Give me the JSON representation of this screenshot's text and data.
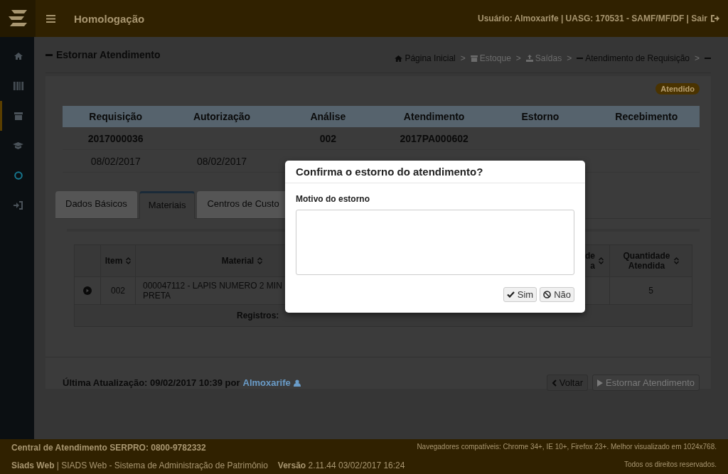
{
  "header": {
    "title": "Homologação",
    "user_info": "Usuário: Almoxarife | UASG: 170531 - SAMF/MF/DF | Sair"
  },
  "sidebar": {
    "items": [
      {
        "kind": "home",
        "selected": false
      },
      {
        "kind": "barcode",
        "selected": false
      },
      {
        "kind": "box",
        "selected": true
      },
      {
        "kind": "cap",
        "selected": false
      },
      {
        "kind": "circle",
        "selected": false
      },
      {
        "kind": "signin",
        "selected": false
      }
    ]
  },
  "page_title": "Estornar Atendimento",
  "breadcrumb": [
    {
      "kind": "home",
      "label": "Página Inicial",
      "disabled": false
    },
    {
      "separator": ">",
      "kind": "box",
      "label": "Estoque",
      "disabled": true
    },
    {
      "separator": ">",
      "kind": "upload",
      "label": "Saídas",
      "disabled": true
    },
    {
      "separator": ">",
      "kind": "dash",
      "label": "Atendimento de Requisição",
      "disabled": false
    },
    {
      "separator": ">",
      "kind": "dash",
      "disabled": false
    }
  ],
  "status_badge": "Atendido",
  "summary": {
    "columns": [
      "Requisição",
      "Autorização",
      "Análise",
      "Atendimento",
      "Estorno",
      "Recebimento"
    ],
    "rows": [
      {
        "bold": true,
        "cells": [
          "2017000036",
          null,
          "002",
          "2017PA000602",
          null,
          null
        ]
      },
      {
        "bold": false,
        "cells": [
          "08/02/2017",
          "08/02/2017",
          null,
          null,
          null,
          null
        ]
      }
    ]
  },
  "tabs": [
    {
      "label": "Dados Básicos",
      "selected": false
    },
    {
      "label": "Materiais",
      "selected": true
    },
    {
      "label": "Centros de Custo",
      "selected": false
    }
  ],
  "materials": {
    "columns": [
      {
        "kind": "blank"
      },
      {
        "kind": "sort",
        "lines": [
          "Item"
        ]
      },
      {
        "kind": "sort",
        "lines": [
          "Material"
        ]
      },
      {
        "kind": "cut",
        "lines": [
          "de",
          "a"
        ]
      },
      {
        "kind": "sort",
        "lines": [
          "Quantidade",
          "Atendida"
        ]
      }
    ],
    "rows": [
      {
        "cells": [
          null,
          "002",
          "000047112 - LAPIS NUMERO 2 MIN\nPRETA",
          null,
          "5"
        ]
      }
    ],
    "footer_label": "Registros:"
  },
  "last_update": {
    "text": "Última Atualização: 09/02/2017 10:39 por",
    "user": "Almoxarife"
  },
  "actions": [
    {
      "kind": "back",
      "label": "Voltar",
      "disabled": false
    },
    {
      "kind": "play",
      "label": "Estornar Atendimento",
      "disabled": true
    }
  ],
  "footer": {
    "support": "Central de Atendimento SERPRO: 0800-9782332",
    "browsers": "Navegadores compatíveis: Chrome 34+, IE 10+, Firefox 23+. Melhor visualizado em 1024x768.",
    "system": "**Siads Web** | SIADS Web - Sistema de Administração de Patrimônio",
    "version": "**Versão** 2.11.44 03/02/2017 16:24",
    "rights": "Todos os direitos reservados."
  },
  "modal": {
    "title": "Confirma o estorno do atendimento?",
    "field_label": "Motivo do estorno",
    "buttons": [
      {
        "kind": "confirm",
        "label": "Sim"
      },
      {
        "kind": "cancel",
        "label": "Não"
      }
    ]
  }
}
